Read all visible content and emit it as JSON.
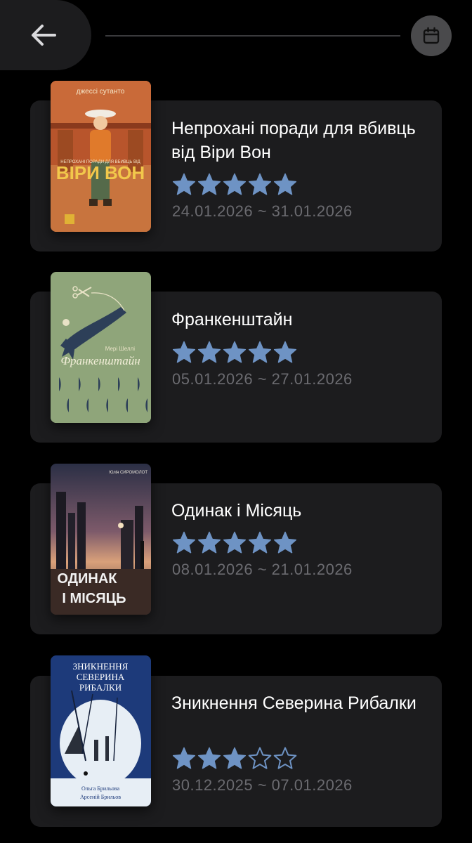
{
  "header": {
    "back_icon": "arrow-left-icon",
    "calendar_icon": "calendar-icon"
  },
  "colors": {
    "background": "#000000",
    "card": "#1c1c1e",
    "star": "#6e93c4",
    "date_text": "#6b6b70"
  },
  "books": [
    {
      "title": "Непрохані поради для вбивць від Віри Вон",
      "rating": 5,
      "dates": "24.01.2026 ~ 31.01.2026",
      "cover": {
        "author": "джессі сутанто",
        "subtitle": "НЕПРОХАНІ ПОРАДИ ДЛЯ ВБИВЦЬ ВІД",
        "title": "ВІРИ ВОН"
      }
    },
    {
      "title": "Франкенштайн",
      "rating": 5,
      "dates": "05.01.2026 ~ 27.01.2026",
      "cover": {
        "author": "Мері Шеллі",
        "title": "Франкенштайн"
      }
    },
    {
      "title": "Одинак і Місяць",
      "rating": 5,
      "dates": "08.01.2026 ~ 21.01.2026",
      "cover": {
        "author": "Юлія СИРОМОЛОТ",
        "title_line1": "ОДИНАК",
        "title_line2": "І МІСЯЦЬ"
      }
    },
    {
      "title": "Зникнення Северина Рибалки",
      "rating": 3,
      "dates": "30.12.2025 ~ 07.01.2026",
      "cover": {
        "title_line1": "ЗНИКНЕННЯ",
        "title_line2": "СЕВЕРИНА",
        "title_line3": "РИБАЛКИ",
        "author_line1": "Ольга Брильова",
        "author_line2": "Арсеній Брильов"
      }
    }
  ]
}
